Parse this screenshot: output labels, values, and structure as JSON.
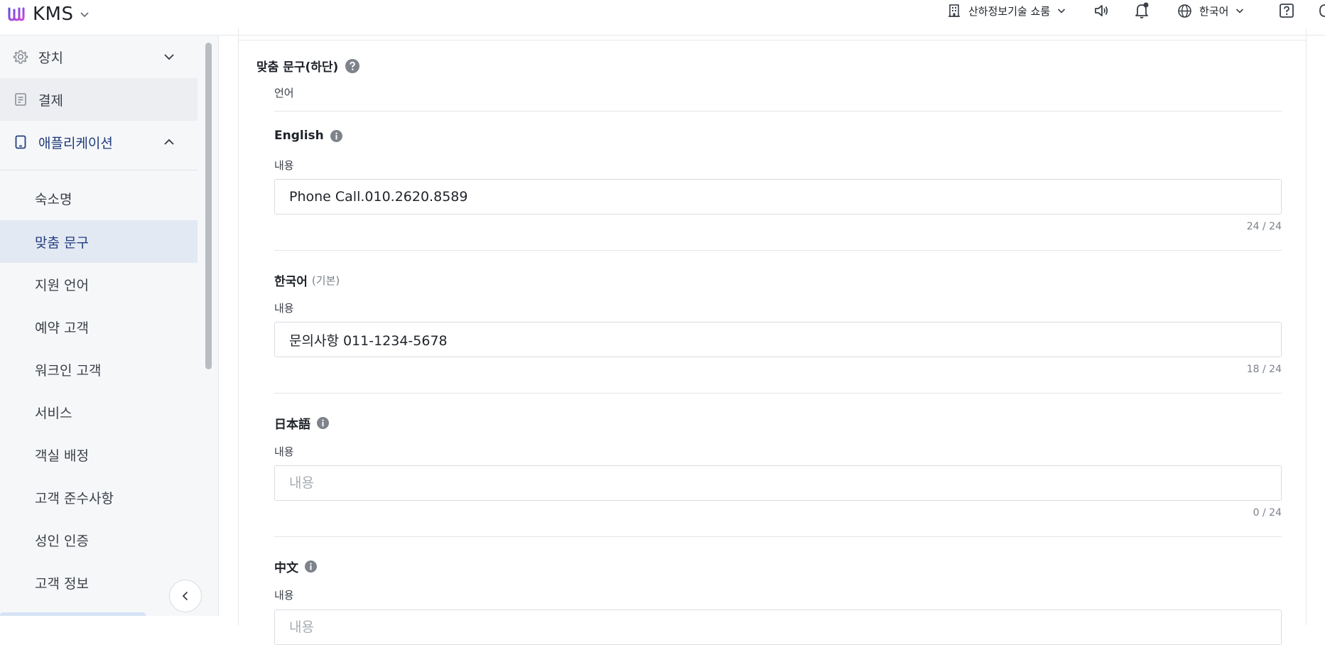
{
  "header": {
    "app_name": "KMS",
    "store_name": "산하정보기술 쇼룸",
    "language": "한국어"
  },
  "sidebar": {
    "items": [
      {
        "label": "장치",
        "icon": "gear-icon",
        "expanded": false
      },
      {
        "label": "결제",
        "icon": "receipt-icon",
        "active": true
      },
      {
        "label": "애플리케이션",
        "icon": "tablet-icon",
        "expanded": true
      }
    ],
    "sub_items": [
      {
        "label": "숙소명"
      },
      {
        "label": "맞춤 문구",
        "active": true
      },
      {
        "label": "지원 언어"
      },
      {
        "label": "예약 고객"
      },
      {
        "label": "워크인 고객"
      },
      {
        "label": "서비스"
      },
      {
        "label": "객실 배정"
      },
      {
        "label": "고객 준수사항"
      },
      {
        "label": "성인 인증"
      },
      {
        "label": "고객 정보"
      }
    ]
  },
  "main": {
    "section_title": "맞춤 문구(하단)",
    "language_header": "언어",
    "languages": [
      {
        "title": "English",
        "subtitle": "",
        "has_info": true,
        "field_label": "내용",
        "value": "Phone Call.010.2620.8589",
        "placeholder": "내용",
        "counter": "24 / 24"
      },
      {
        "title": "한국어",
        "subtitle": "(기본)",
        "has_info": false,
        "field_label": "내용",
        "value": "문의사항 011-1234-5678",
        "placeholder": "내용",
        "counter": "18 / 24"
      },
      {
        "title": "日本語",
        "subtitle": "",
        "has_info": true,
        "field_label": "내용",
        "value": "",
        "placeholder": "내용",
        "counter": "0 / 24"
      },
      {
        "title": "中文",
        "subtitle": "",
        "has_info": true,
        "field_label": "내용",
        "value": "",
        "placeholder": "내용",
        "counter": ""
      }
    ]
  },
  "colors": {
    "accent": "#24407f",
    "sidebar_bg": "#f6f7f9",
    "active_sub_bg": "#e3e9f3",
    "icon_gray": "#8a8f96"
  }
}
